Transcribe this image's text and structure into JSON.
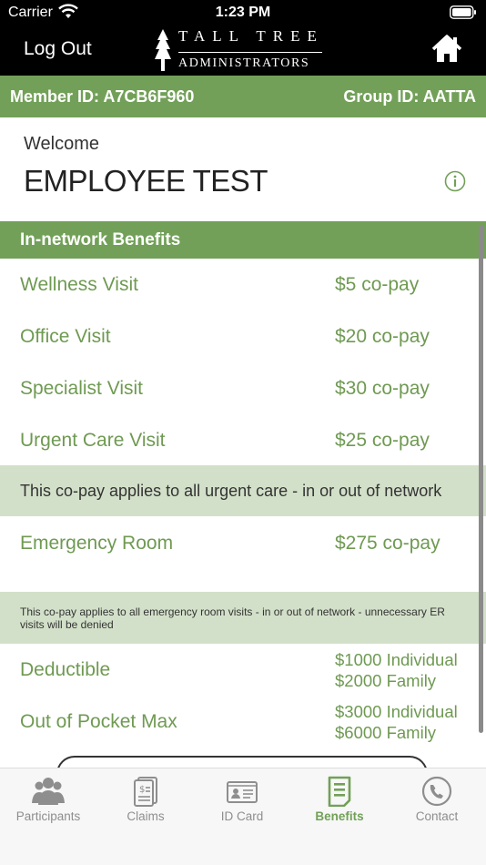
{
  "status_bar": {
    "carrier": "Carrier",
    "time": "1:23 PM"
  },
  "nav": {
    "logout_label": "Log Out",
    "logo_line1": "TALL TREE",
    "logo_line2": "ADMINISTRATORS",
    "home_icon": "home-icon"
  },
  "ids": {
    "member": "Member ID: A7CB6F960",
    "group": "Group ID: AATTA"
  },
  "welcome": {
    "label": "Welcome",
    "name": "EMPLOYEE TEST",
    "info_icon": "info-icon"
  },
  "benefits": {
    "header": "In-network Benefits",
    "rows": [
      {
        "label": "Wellness Visit",
        "value": "$5 co-pay"
      },
      {
        "label": "Office Visit",
        "value": "$20 co-pay"
      },
      {
        "label": "Specialist Visit",
        "value": "$30 co-pay"
      },
      {
        "label": "Urgent Care Visit",
        "value": "$25 co-pay"
      },
      {
        "label": "Emergency Room",
        "value": "$275 co-pay"
      }
    ],
    "urgent_note": "This co-pay applies to all urgent care - in or out of network",
    "er_note": "This co-pay applies to all emergency room visits - in or out of network - unnecessary ER visits will be denied",
    "deductible": {
      "label": "Deductible",
      "individual": "$1000 Individual",
      "family": "$2000 Family"
    },
    "oop_max": {
      "label": "Out of Pocket Max",
      "individual": "$3000 Individual",
      "family": "$6000 Family"
    }
  },
  "tabs": [
    {
      "label": "Participants",
      "icon": "participants-icon",
      "active": false
    },
    {
      "label": "Claims",
      "icon": "claims-icon",
      "active": false
    },
    {
      "label": "ID Card",
      "icon": "id-card-icon",
      "active": false
    },
    {
      "label": "Benefits",
      "icon": "benefits-icon",
      "active": true
    },
    {
      "label": "Contact",
      "icon": "contact-icon",
      "active": false
    }
  ],
  "colors": {
    "brand_green": "#72a058",
    "text_green": "#6f9a52",
    "note_band": "#d3e0c9",
    "tab_inactive": "#8e8e8e"
  }
}
